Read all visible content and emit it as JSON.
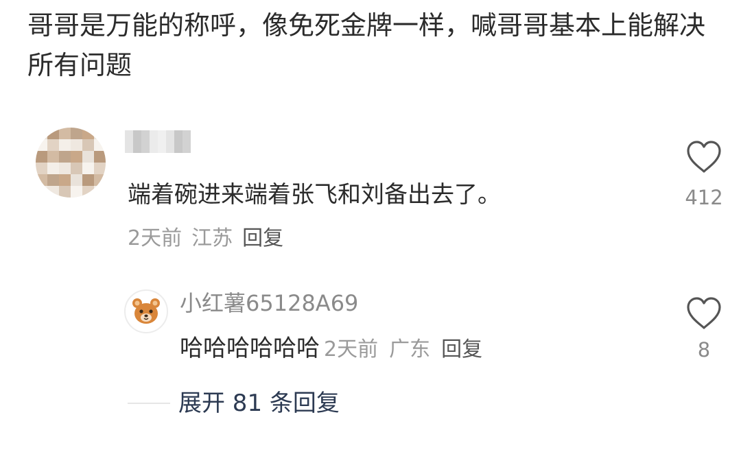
{
  "post": {
    "text": "哥哥是万能的称呼，像免死金牌一样，喊哥哥基本上能解决所有问题"
  },
  "comment": {
    "text": "端着碗进来端着张飞和刘备出去了。",
    "time": "2天前",
    "location": "江苏",
    "reply_label": "回复",
    "likes": "412",
    "avatar_icon": "blurred-avatar",
    "like_icon": "heart-outline-icon"
  },
  "sub_reply": {
    "username": "小红薯65128A69",
    "text": "哈哈哈哈哈哈",
    "time": "2天前",
    "location": "广东",
    "reply_label": "回复",
    "likes": "8",
    "avatar_icon": "bear-avatar-icon",
    "like_icon": "heart-outline-icon"
  },
  "expand": {
    "label": "展开 81 条回复"
  },
  "colors": {
    "text_primary": "#2b2b2b",
    "text_secondary": "#9a9a9a",
    "link": "#2c3a52",
    "bear": "#d9863a"
  }
}
